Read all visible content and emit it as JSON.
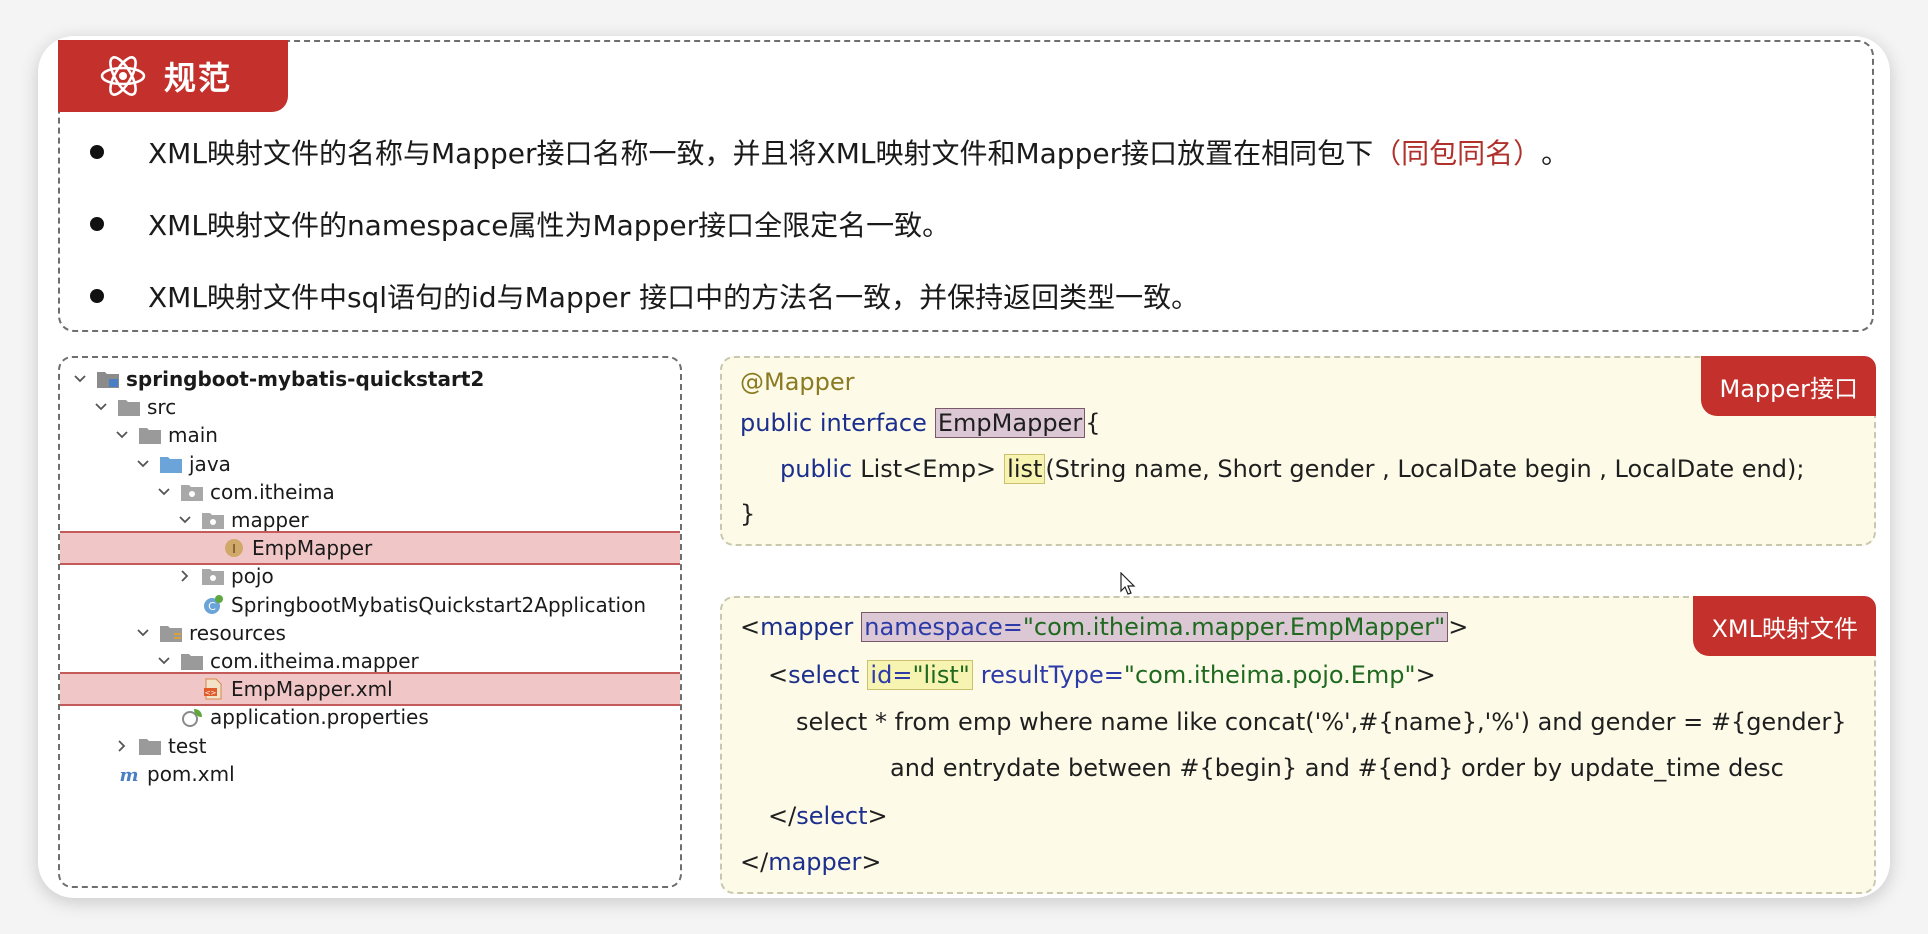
{
  "header": {
    "title": "规范",
    "icon": "atom-icon"
  },
  "rules": [
    {
      "text": "XML映射文件的名称与Mapper接口名称一致，并且将XML映射文件和Mapper接口放置在相同包下",
      "accent": "（同包同名）",
      "end": "。"
    },
    {
      "text": "XML映射文件的namespace属性为Mapper接口全限定名一致。",
      "accent": "",
      "end": ""
    },
    {
      "text": "XML映射文件中sql语句的id与Mapper 接口中的方法名一致，并保持返回类型一致。",
      "accent": "",
      "end": ""
    }
  ],
  "tree": [
    {
      "label": "springboot-mybatis-quickstart2",
      "icon": "module-folder-icon",
      "chevron": "down",
      "indent": 0,
      "bold": true,
      "selected": false
    },
    {
      "label": "src",
      "icon": "folder-icon",
      "chevron": "down",
      "indent": 1,
      "bold": false,
      "selected": false
    },
    {
      "label": "main",
      "icon": "folder-icon",
      "chevron": "down",
      "indent": 2,
      "bold": false,
      "selected": false
    },
    {
      "label": "java",
      "icon": "source-folder-icon",
      "chevron": "down",
      "indent": 3,
      "bold": false,
      "selected": false
    },
    {
      "label": "com.itheima",
      "icon": "package-icon",
      "chevron": "down",
      "indent": 4,
      "bold": false,
      "selected": false
    },
    {
      "label": "mapper",
      "icon": "package-icon",
      "chevron": "down",
      "indent": 5,
      "bold": false,
      "selected": false
    },
    {
      "label": "EmpMapper",
      "icon": "interface-icon",
      "chevron": "none",
      "indent": 6,
      "bold": false,
      "selected": true
    },
    {
      "label": "pojo",
      "icon": "package-icon",
      "chevron": "right",
      "indent": 5,
      "bold": false,
      "selected": false
    },
    {
      "label": "SpringbootMybatisQuickstart2Application",
      "icon": "spring-class-icon",
      "chevron": "none",
      "indent": 5,
      "bold": false,
      "selected": false
    },
    {
      "label": "resources",
      "icon": "resources-folder-icon",
      "chevron": "down",
      "indent": 3,
      "bold": false,
      "selected": false
    },
    {
      "label": "com.itheima.mapper",
      "icon": "folder-icon",
      "chevron": "down",
      "indent": 4,
      "bold": false,
      "selected": false
    },
    {
      "label": "EmpMapper.xml",
      "icon": "xml-file-icon",
      "chevron": "none",
      "indent": 5,
      "bold": false,
      "selected": true
    },
    {
      "label": "application.properties",
      "icon": "properties-icon",
      "chevron": "none",
      "indent": 4,
      "bold": false,
      "selected": false
    },
    {
      "label": "test",
      "icon": "folder-icon",
      "chevron": "right",
      "indent": 2,
      "bold": false,
      "selected": false
    },
    {
      "label": "pom.xml",
      "icon": "maven-icon",
      "chevron": "none",
      "indent": 1,
      "bold": false,
      "selected": false
    }
  ],
  "mapper_panel": {
    "tag": "Mapper接口",
    "annotation": "@Mapper",
    "decl_kw": "public interface",
    "iface_name": "EmpMapper",
    "open_brace": "{",
    "method_kw": "public",
    "method_ret": "List<Emp>",
    "method_name": "list",
    "method_params": "(String name, Short gender , LocalDate begin , LocalDate end);",
    "close_brace": "}"
  },
  "xml_panel": {
    "tag": "XML映射文件",
    "open_lt": "<",
    "mapper_tag": "mapper",
    "ns_attr": "namespace=",
    "ns_value": "\"com.itheima.mapper.EmpMapper\"",
    "gt": ">",
    "select_tag": "select",
    "id_attr": "id=",
    "id_value": "\"list\"",
    "rt_attr": "resultType=",
    "rt_value": "\"com.itheima.pojo.Emp\"",
    "sql_line1": "select * from emp where name like concat('%',#{name},'%') and gender = #{gender}",
    "sql_line2": "and entrydate between #{begin} and #{end} order by update_time desc",
    "close_select_lt": "</",
    "close_mapper_lt": "</"
  },
  "colors": {
    "accent": "#c4302b",
    "panel_bg": "#fdfbe8",
    "selection": "#f0c6c6"
  }
}
